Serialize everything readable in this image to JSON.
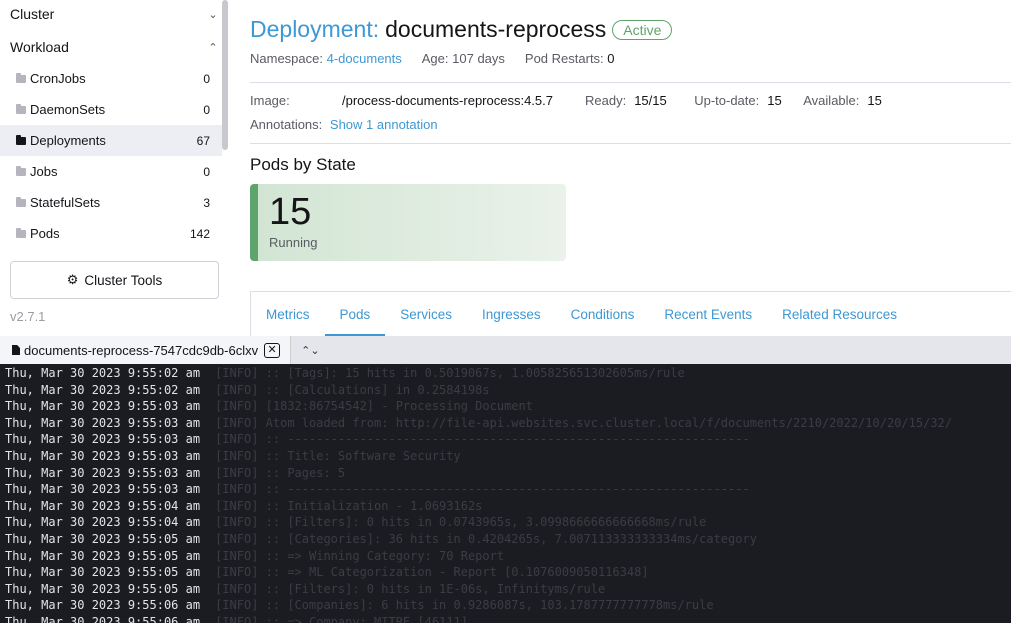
{
  "sidebar": {
    "groups": [
      {
        "label": "Cluster",
        "chevron": "chevron-down-icon"
      },
      {
        "label": "Workload",
        "chevron": "chevron-up-icon"
      }
    ],
    "items": [
      {
        "label": "CronJobs",
        "count": "0"
      },
      {
        "label": "DaemonSets",
        "count": "0"
      },
      {
        "label": "Deployments",
        "count": "67"
      },
      {
        "label": "Jobs",
        "count": "0"
      },
      {
        "label": "StatefulSets",
        "count": "3"
      },
      {
        "label": "Pods",
        "count": "142"
      }
    ],
    "tools_label": "Cluster Tools",
    "version": "v2.7.1"
  },
  "header": {
    "kind": "Deployment:",
    "name": "documents-reprocess",
    "status": "Active",
    "namespace_label": "Namespace:",
    "namespace": "4-documents",
    "age_label": "Age:",
    "age": "107 days",
    "restarts_label": "Pod Restarts:",
    "restarts": "0"
  },
  "details": {
    "image_label": "Image:",
    "image": "/process-documents-reprocess:4.5.7",
    "ready_label": "Ready:",
    "ready": "15/15",
    "uptodate_label": "Up-to-date:",
    "uptodate": "15",
    "available_label": "Available:",
    "available": "15",
    "annotations_label": "Annotations:",
    "annotations_link": "Show 1 annotation"
  },
  "pods_by_state": {
    "title": "Pods by State",
    "count": "15",
    "state": "Running"
  },
  "tabs": [
    "Metrics",
    "Pods",
    "Services",
    "Ingresses",
    "Conditions",
    "Recent Events",
    "Related Resources"
  ],
  "active_tab": "Pods",
  "log_panel": {
    "tab_title": "documents-reprocess-7547cdc9db-6clxv",
    "close_glyph": "✕",
    "updown_glyph": "⌃⌄",
    "lines": [
      {
        "ts": "Thu, Mar 30 2023 9:55:02 am",
        "msg": "[INFO] :: [Tags]: 15 hits in 0.5019067s, 1.005825651302605ms/rule"
      },
      {
        "ts": "Thu, Mar 30 2023 9:55:02 am",
        "msg": "[INFO] :: [Calculations] in 0.2584198s"
      },
      {
        "ts": "Thu, Mar 30 2023 9:55:03 am",
        "msg": "[INFO] [1832:86754542] - Processing Document"
      },
      {
        "ts": "Thu, Mar 30 2023 9:55:03 am",
        "msg": "[INFO] Atom loaded from: http://file-api.websites.svc.cluster.local/f/documents/2210/2022/10/20/15/32/"
      },
      {
        "ts": "Thu, Mar 30 2023 9:55:03 am",
        "msg": "[INFO] :: ----------------------------------------------------------------"
      },
      {
        "ts": "Thu, Mar 30 2023 9:55:03 am",
        "msg": "[INFO] :: Title: Software Security"
      },
      {
        "ts": "Thu, Mar 30 2023 9:55:03 am",
        "msg": "[INFO] :: Pages: 5"
      },
      {
        "ts": "Thu, Mar 30 2023 9:55:03 am",
        "msg": "[INFO] :: ----------------------------------------------------------------"
      },
      {
        "ts": "Thu, Mar 30 2023 9:55:04 am",
        "msg": "[INFO] :: Initialization - 1.0693162s"
      },
      {
        "ts": "Thu, Mar 30 2023 9:55:04 am",
        "msg": "[INFO] :: [Filters]: 0 hits in 0.0743965s, 3.0998666666666668ms/rule"
      },
      {
        "ts": "Thu, Mar 30 2023 9:55:05 am",
        "msg": "[INFO] :: [Categories]: 36 hits in 0.4204265s, 7.007113333333334ms/category"
      },
      {
        "ts": "Thu, Mar 30 2023 9:55:05 am",
        "msg": "[INFO] :: => Winning Category: 70 Report"
      },
      {
        "ts": "Thu, Mar 30 2023 9:55:05 am",
        "msg": "[INFO] :: => ML Categorization - Report [0.1076009050116348]"
      },
      {
        "ts": "Thu, Mar 30 2023 9:55:05 am",
        "msg": "[INFO] :: [Filters]: 0 hits in 1E-06s, Infinityms/rule"
      },
      {
        "ts": "Thu, Mar 30 2023 9:55:06 am",
        "msg": "[INFO] :: [Companies]: 6 hits in 0.9286087s, 103.1787777777778ms/rule"
      },
      {
        "ts": "Thu, Mar 30 2023 9:55:06 am",
        "msg": "[INFO] :: => Company: MITRE [46111]"
      }
    ]
  }
}
